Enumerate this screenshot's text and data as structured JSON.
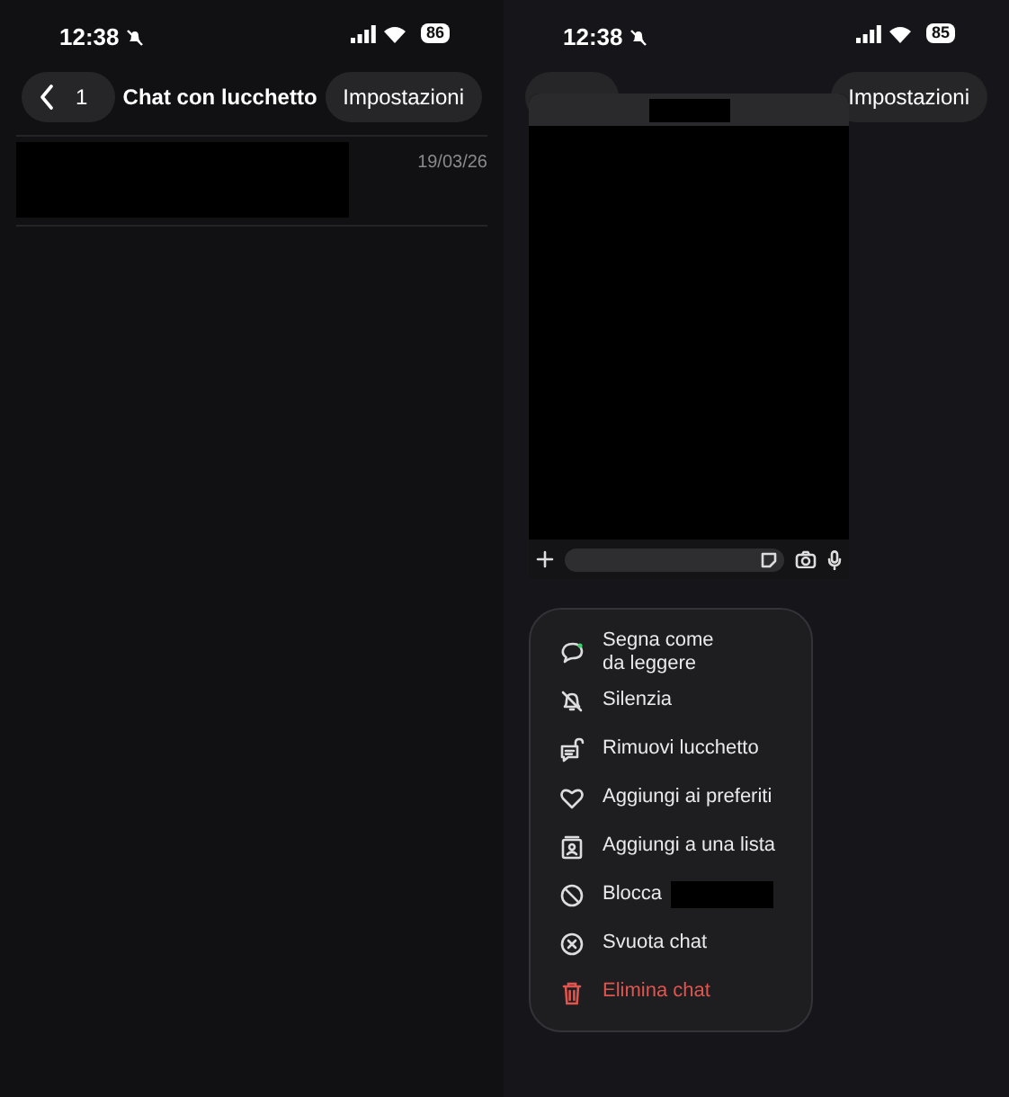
{
  "screens": [
    {
      "status_bar": {
        "time": "12:38",
        "battery": "86"
      },
      "header": {
        "back_count": "1",
        "title": "Chat con lucchetto",
        "action": "Impostazioni"
      },
      "chats": [
        {
          "date": "19/03/26"
        }
      ]
    },
    {
      "status_bar": {
        "time": "12:38",
        "battery": "85"
      },
      "header": {
        "action": "Impostazioni"
      },
      "menu": [
        {
          "label": "Segna come\nda leggere",
          "kind": "normal",
          "redacted": false
        },
        {
          "label": "Silenzia",
          "kind": "normal",
          "redacted": false
        },
        {
          "label": "Rimuovi lucchetto",
          "kind": "normal",
          "redacted": false
        },
        {
          "label": "Aggiungi ai preferiti",
          "kind": "normal",
          "redacted": false
        },
        {
          "label": "Aggiungi a una lista",
          "kind": "normal",
          "redacted": false
        },
        {
          "label": "Blocca",
          "kind": "normal",
          "redacted": true
        },
        {
          "label": "Svuota chat",
          "kind": "normal",
          "redacted": false
        },
        {
          "label": "Elimina chat",
          "kind": "destructive",
          "redacted": false
        }
      ]
    }
  ]
}
